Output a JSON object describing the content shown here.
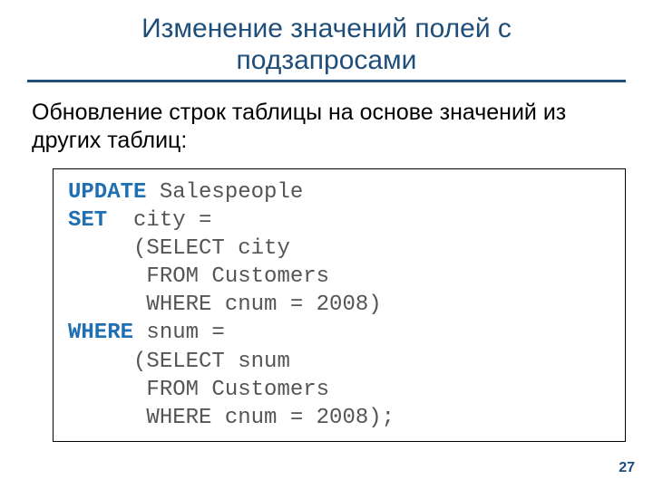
{
  "slide": {
    "title_line1": "Изменение значений полей с",
    "title_line2": "подзапросами",
    "subtitle": "Обновление строк таблицы на основе значений из других таблиц:",
    "page_number": "27"
  },
  "code": {
    "kw_update": "UPDATE",
    "t_update_rest": " Salespeople",
    "kw_set": "SET",
    "t_set_rest": "  city =",
    "t_l3": "     (SELECT city",
    "t_l4": "      FROM Customers",
    "t_l5": "      WHERE cnum = 2008)",
    "kw_where": "WHERE",
    "t_where_rest": " snum =",
    "t_l7": "     (SELECT snum",
    "t_l8": "      FROM Customers",
    "t_l9": "      WHERE cnum = 2008);"
  }
}
